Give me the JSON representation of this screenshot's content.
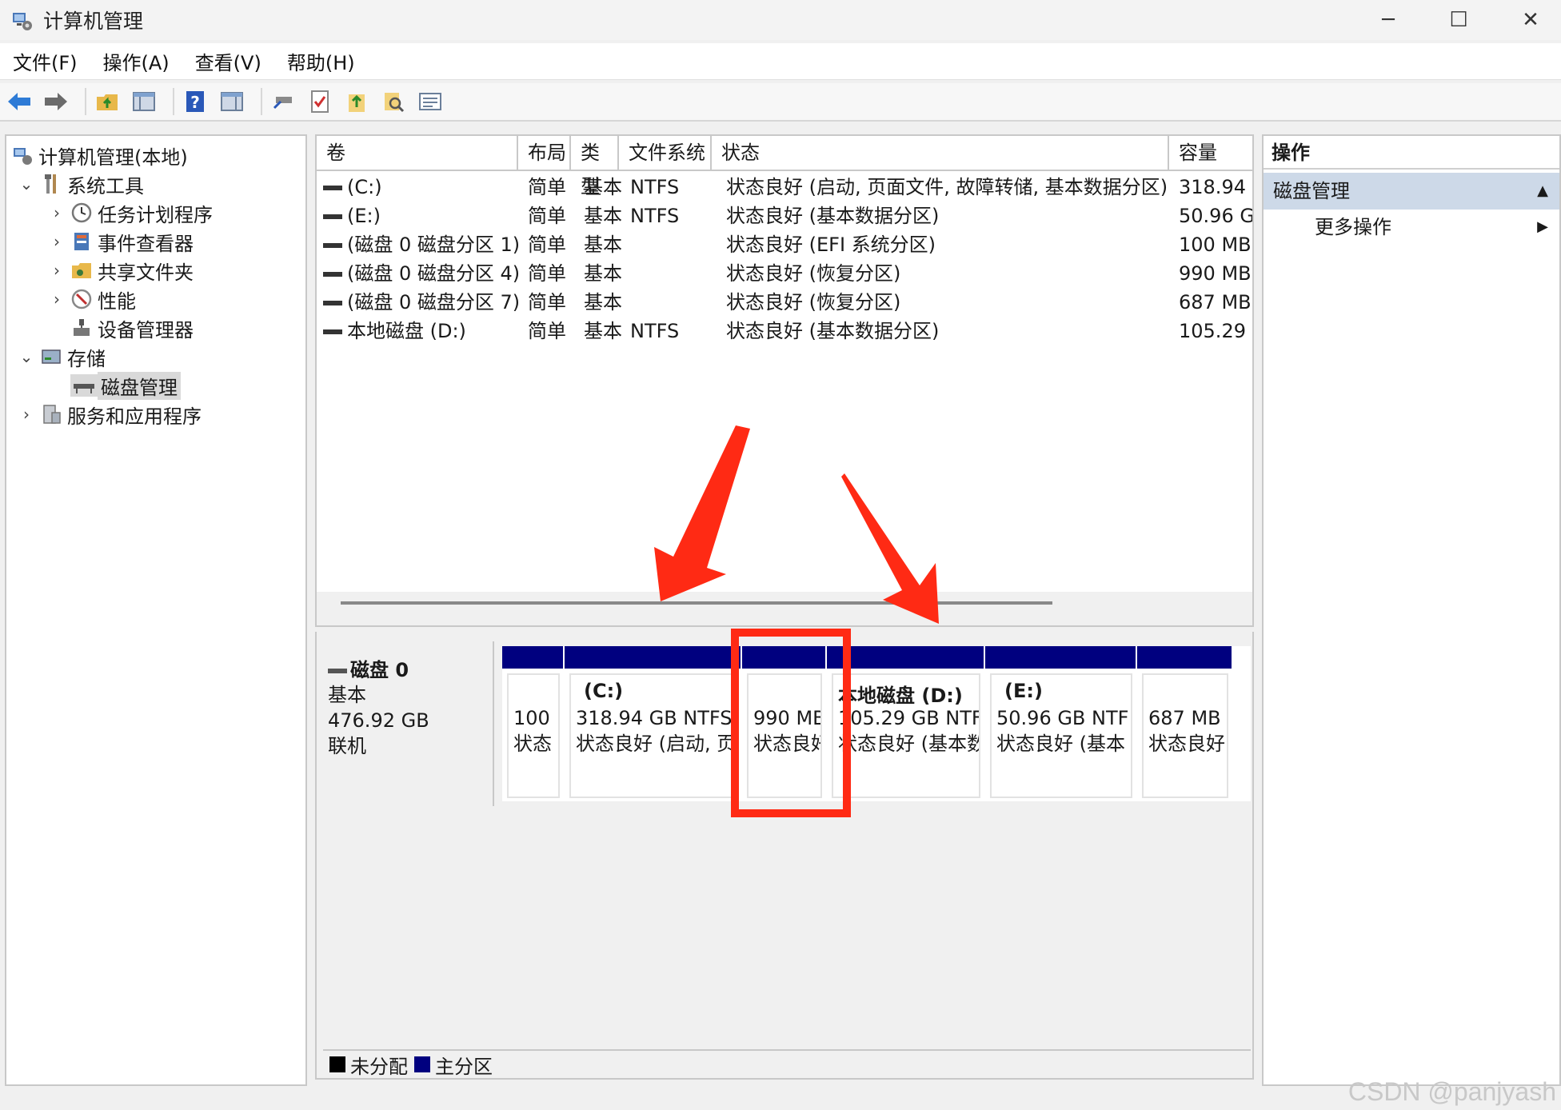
{
  "window": {
    "title": "计算机管理",
    "minimize": "─",
    "maximize": "☐",
    "close": "✕"
  },
  "menu": [
    "文件(F)",
    "操作(A)",
    "查看(V)",
    "帮助(H)"
  ],
  "tree": {
    "root": "计算机管理(本地)",
    "system_tools": "系统工具",
    "task_scheduler": "任务计划程序",
    "event_viewer": "事件查看器",
    "shared_folders": "共享文件夹",
    "performance": "性能",
    "device_manager": "设备管理器",
    "storage": "存储",
    "disk_management": "磁盘管理",
    "services_apps": "服务和应用程序"
  },
  "volumes": {
    "headers": [
      "卷",
      "布局",
      "类型",
      "文件系统",
      "状态",
      "容量"
    ],
    "rows": [
      {
        "name": "(C:)",
        "layout": "简单",
        "type": "基本",
        "fs": "NTFS",
        "status": "状态良好 (启动, 页面文件, 故障转储, 基本数据分区)",
        "capacity": "318.94"
      },
      {
        "name": "(E:)",
        "layout": "简单",
        "type": "基本",
        "fs": "NTFS",
        "status": "状态良好 (基本数据分区)",
        "capacity": "50.96 G"
      },
      {
        "name": "(磁盘 0 磁盘分区 1)",
        "layout": "简单",
        "type": "基本",
        "fs": "",
        "status": "状态良好 (EFI 系统分区)",
        "capacity": "100 MB"
      },
      {
        "name": "(磁盘 0 磁盘分区 4)",
        "layout": "简单",
        "type": "基本",
        "fs": "",
        "status": "状态良好 (恢复分区)",
        "capacity": "990 MB"
      },
      {
        "name": "(磁盘 0 磁盘分区 7)",
        "layout": "简单",
        "type": "基本",
        "fs": "",
        "status": "状态良好 (恢复分区)",
        "capacity": "687 MB"
      },
      {
        "name": "本地磁盘 (D:)",
        "layout": "简单",
        "type": "基本",
        "fs": "NTFS",
        "status": "状态良好 (基本数据分区)",
        "capacity": "105.29"
      }
    ]
  },
  "disk": {
    "name": "磁盘 0",
    "kind": "基本",
    "size": "476.92 GB",
    "state": "联机",
    "partitions": [
      {
        "name": "",
        "size": "100",
        "status": "状态"
      },
      {
        "name": "(C:)",
        "size": "318.94 GB NTFS",
        "status": "状态良好 (启动, 页"
      },
      {
        "name": "",
        "size": "990 MB",
        "status": "状态良好"
      },
      {
        "name": "本地磁盘 (D:)",
        "size": "105.29 GB NTF",
        "status": "状态良好 (基本数"
      },
      {
        "name": "(E:)",
        "size": "50.96 GB NTF",
        "status": "状态良好 (基本"
      },
      {
        "name": "",
        "size": "687 MB",
        "status": "状态良好"
      }
    ]
  },
  "legend": {
    "unallocated": "未分配",
    "primary": "主分区",
    "unallocated_color": "#000000",
    "primary_color": "#00007f"
  },
  "actions": {
    "header": "操作",
    "section": "磁盘管理",
    "more": "更多操作"
  },
  "annotation_color": "#ff2a14",
  "watermark": "CSDN @panjyash"
}
